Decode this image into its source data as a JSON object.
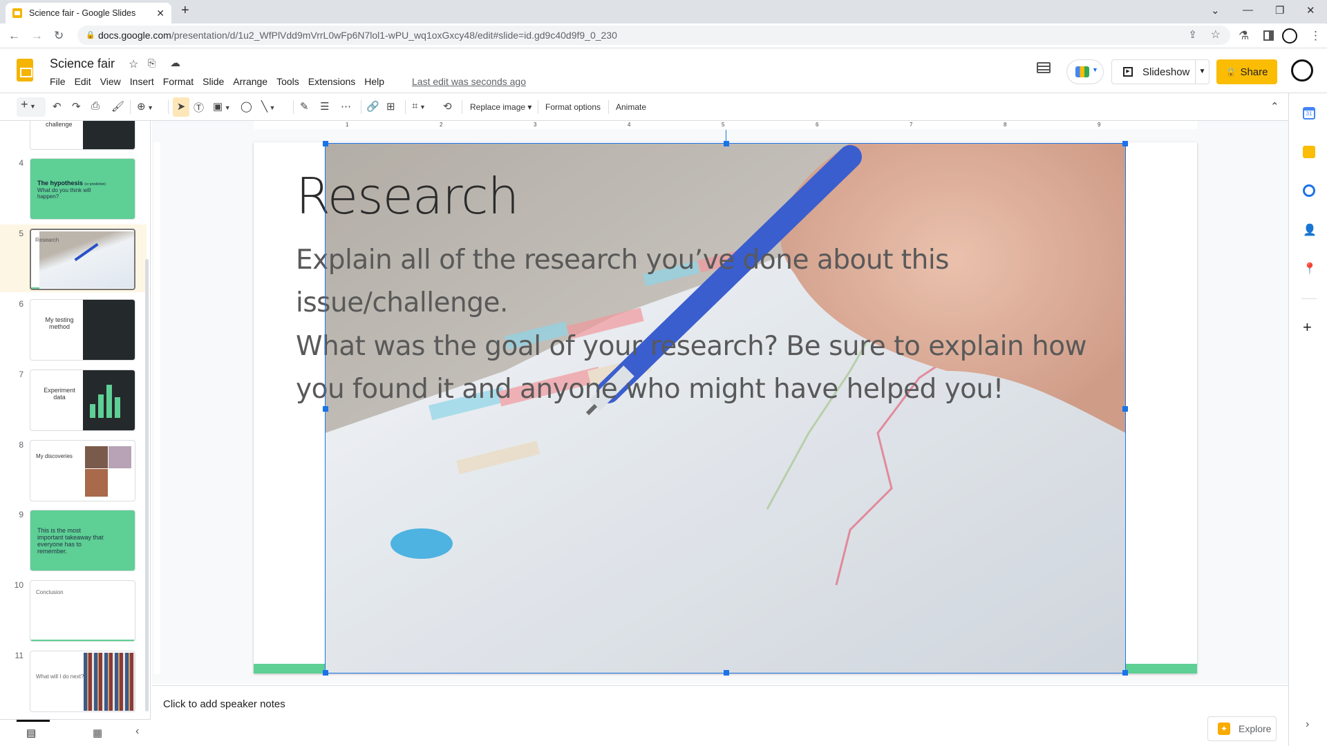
{
  "browser": {
    "tab_title": "Science fair - Google Slides",
    "url_domain": "docs.google.com",
    "url_path": "/presentation/d/1u2_WfPlVdd9mVrrL0wFp6N7lol1-wPU_wq1oxGxcy48/edit#slide=id.gd9c40d9f9_0_230"
  },
  "app": {
    "doc_title": "Science fair",
    "menu": [
      "File",
      "Edit",
      "View",
      "Insert",
      "Format",
      "Slide",
      "Arrange",
      "Tools",
      "Extensions",
      "Help"
    ],
    "last_edit": "Last edit was seconds ago",
    "slideshow_label": "Slideshow",
    "share_label": "Share"
  },
  "toolbar": {
    "replace_image": "Replace image ▾",
    "format_options": "Format options",
    "animate": "Animate"
  },
  "ruler": {
    "ticks": [
      "1",
      "2",
      "3",
      "4",
      "5",
      "6",
      "7",
      "8",
      "9"
    ]
  },
  "slides": [
    {
      "num": "",
      "title": "challenge",
      "style": "dark-split"
    },
    {
      "num": "4",
      "title": "The hypothesis",
      "sub": "(or prediction)",
      "body": "What do you think will happen?",
      "style": "green"
    },
    {
      "num": "5",
      "title": "Research",
      "style": "photo",
      "selected": true
    },
    {
      "num": "6",
      "title": "My testing method",
      "style": "dark-split"
    },
    {
      "num": "7",
      "title": "Experiment data",
      "style": "dark-chart"
    },
    {
      "num": "8",
      "title": "My discoveries",
      "style": "photos"
    },
    {
      "num": "9",
      "title": "This is the most important takeaway that everyone has to remember.",
      "style": "green"
    },
    {
      "num": "10",
      "title": "Conclusion",
      "style": "plain"
    },
    {
      "num": "11",
      "title": "What will I do next?",
      "style": "books"
    }
  ],
  "slide": {
    "title": "Research",
    "body1": "Explain all of the research you’ve done about this issue/challenge.",
    "body2": "What was the goal of your research? Be sure to explain how you found it and anyone who might have helped you!"
  },
  "notes": {
    "placeholder": "Click to add speaker notes"
  },
  "explore": {
    "label": "Explore"
  },
  "colors": {
    "accent_green": "#5ecf95",
    "share_yellow": "#fbbc04",
    "selection_blue": "#1a73e8",
    "slides_yellow": "#f4b400"
  }
}
